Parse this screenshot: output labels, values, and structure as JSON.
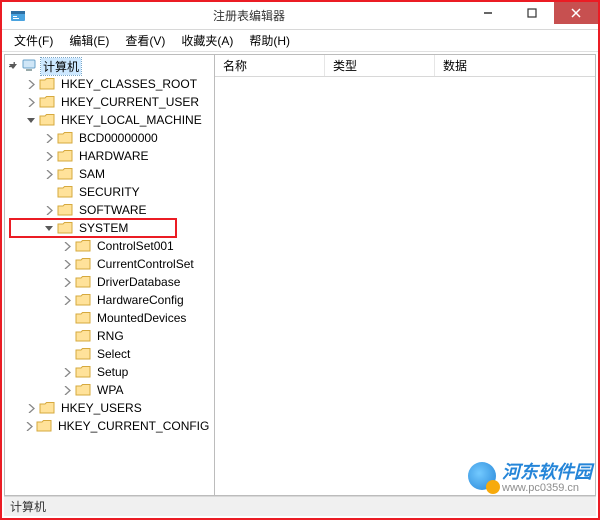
{
  "window": {
    "title": "注册表编辑器",
    "icon": "regedit-icon"
  },
  "menu": {
    "file": "文件(F)",
    "edit": "编辑(E)",
    "view": "查看(V)",
    "fav": "收藏夹(A)",
    "help": "帮助(H)"
  },
  "columns": {
    "name": "名称",
    "type": "类型",
    "data": "数据"
  },
  "status": "计算机",
  "tree": {
    "root": "计算机",
    "hkcr": "HKEY_CLASSES_ROOT",
    "hkcu": "HKEY_CURRENT_USER",
    "hklm": "HKEY_LOCAL_MACHINE",
    "hklm_children": {
      "bcd": "BCD00000000",
      "hardware": "HARDWARE",
      "sam": "SAM",
      "security": "SECURITY",
      "software": "SOFTWARE",
      "system": "SYSTEM"
    },
    "system_children": {
      "cs001": "ControlSet001",
      "ccs": "CurrentControlSet",
      "drvdb": "DriverDatabase",
      "hwcfg": "HardwareConfig",
      "md": "MountedDevices",
      "rng": "RNG",
      "select": "Select",
      "setup": "Setup",
      "wpa": "WPA"
    },
    "hku": "HKEY_USERS",
    "hkcc": "HKEY_CURRENT_CONFIG"
  },
  "watermark": {
    "name": "河东软件园",
    "url": "www.pc0359.cn"
  }
}
